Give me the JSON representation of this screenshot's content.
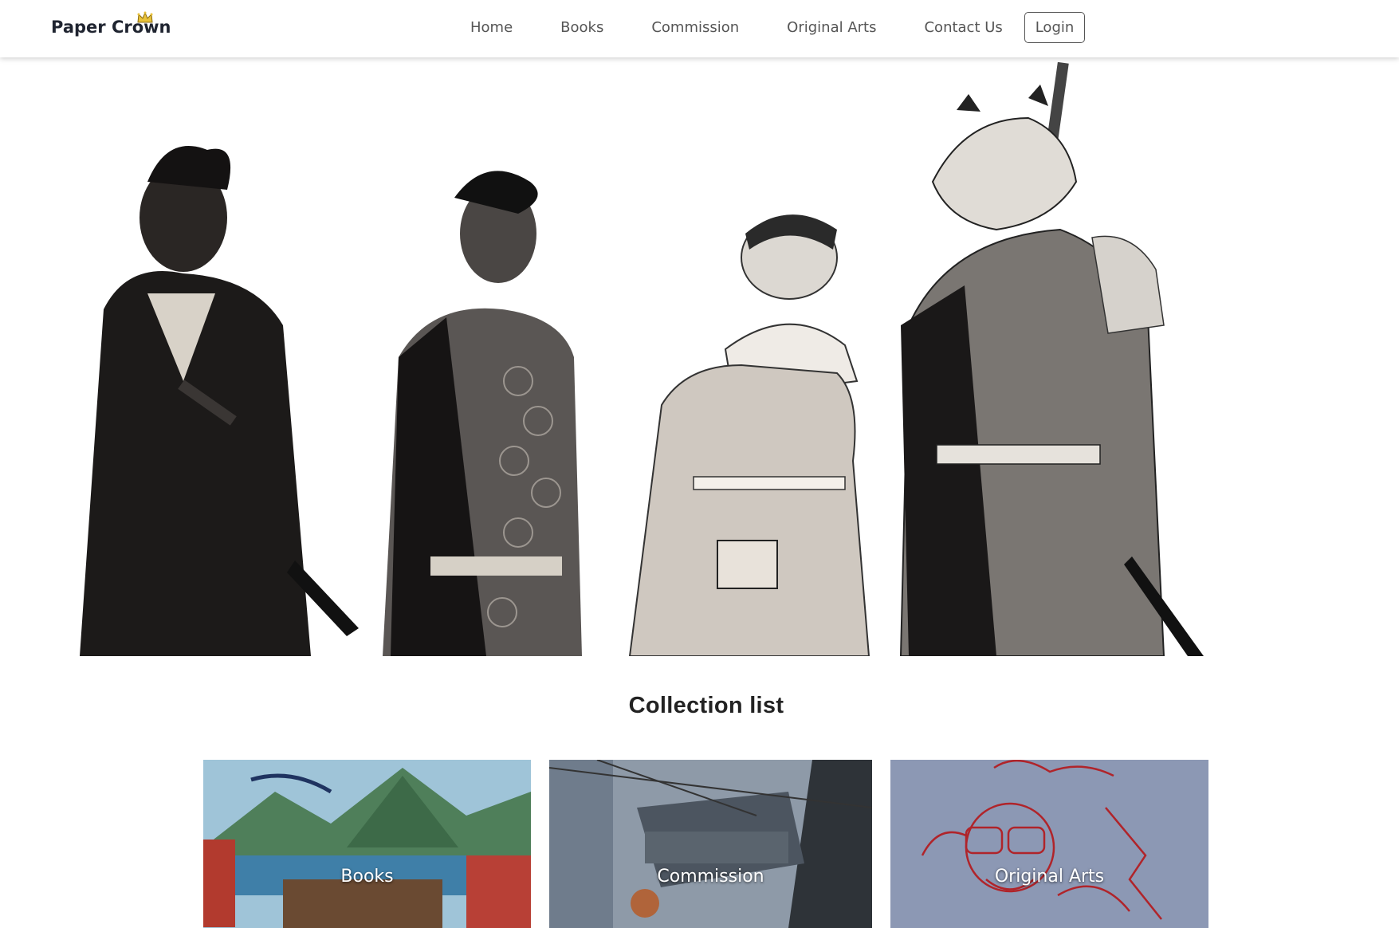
{
  "brand": {
    "name": "Paper Crown",
    "icon": "crown-icon",
    "crown_color": "#e0b020"
  },
  "nav": {
    "items": [
      {
        "label": "Home"
      },
      {
        "label": "Books"
      },
      {
        "label": "Commission"
      },
      {
        "label": "Original Arts"
      },
      {
        "label": "Contact Us"
      }
    ],
    "login_label": "Login"
  },
  "hero": {
    "description_icon": "samurai-illustration-banner"
  },
  "collection": {
    "title": "Collection list",
    "cards": [
      {
        "label": "Books",
        "tint": "#5a8fb8"
      },
      {
        "label": "Commission",
        "tint": "#6f7f92"
      },
      {
        "label": "Original Arts",
        "tint": "#8f9ab8"
      }
    ]
  },
  "colors": {
    "nav_text": "#555555",
    "brand_text": "#1f2430",
    "background": "#ffffff"
  }
}
